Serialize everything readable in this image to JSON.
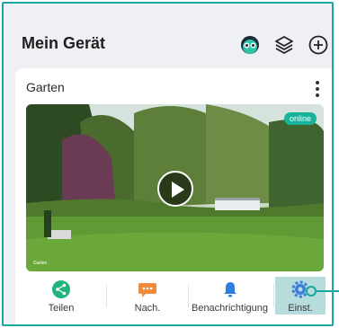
{
  "header": {
    "title": "Mein Gerät",
    "icons": [
      "owl-icon",
      "layers-icon",
      "add-circle-icon"
    ]
  },
  "device": {
    "name": "Garten",
    "status": "online",
    "camera_watermark": "Garten"
  },
  "actions": [
    {
      "label": "Teilen",
      "icon": "share-icon",
      "color": "#1fb37d"
    },
    {
      "label": "Nach.",
      "icon": "chat-icon",
      "color": "#f08a3c"
    },
    {
      "label": "Benachrichtigung",
      "icon": "bell-icon",
      "color": "#2f7de1"
    },
    {
      "label": "Einst.",
      "icon": "gear-icon",
      "color": "#3c7fd8"
    }
  ],
  "colors": {
    "accent": "#17a9a0",
    "online_badge": "#18b39b",
    "selected_bg": "#b7dcdc"
  }
}
